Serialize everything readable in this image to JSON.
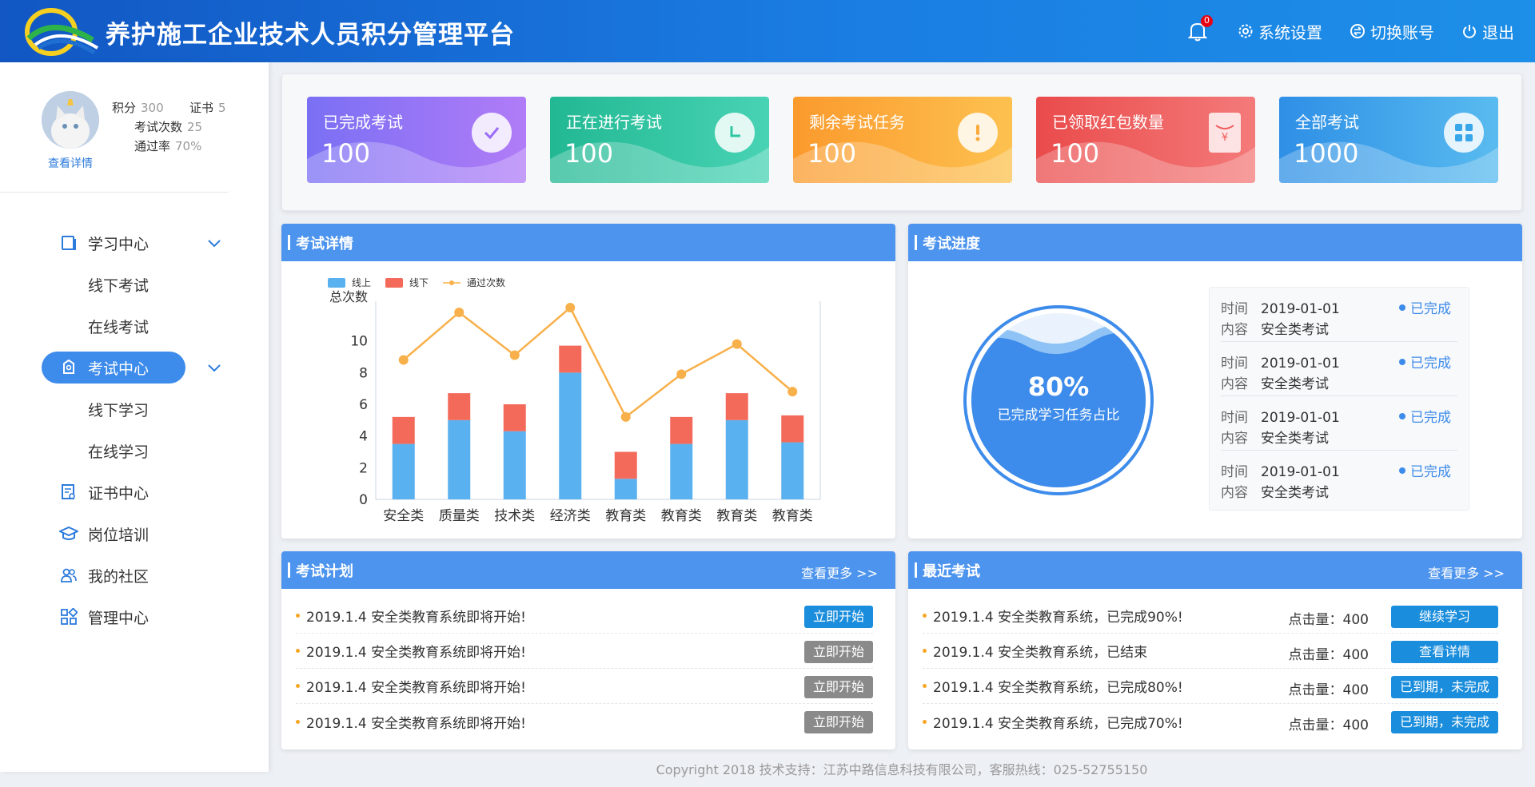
{
  "header": {
    "title": "养护施工企业技术人员积分管理平台",
    "notification_count": "0",
    "settings_label": "系统设置",
    "switch_account_label": "切换账号",
    "logout_label": "退出"
  },
  "profile": {
    "score_label": "积分",
    "score_value": "300",
    "cert_label": "证书",
    "cert_value": "5",
    "exam_count_label": "考试次数",
    "exam_count_value": "25",
    "pass_rate_label": "通过率",
    "pass_rate_value": "70%",
    "view_detail": "查看详情"
  },
  "sidebar": {
    "items": [
      {
        "label": "学习中心",
        "icon": "book-icon"
      },
      {
        "label": "线下考试"
      },
      {
        "label": "在线考试"
      },
      {
        "label": "考试中心",
        "icon": "exam-icon"
      },
      {
        "label": "线下学习"
      },
      {
        "label": "在线学习"
      },
      {
        "label": "证书中心",
        "icon": "certificate-icon"
      },
      {
        "label": "岗位培训",
        "icon": "graduation-cap-icon"
      },
      {
        "label": "我的社区",
        "icon": "community-icon"
      },
      {
        "label": "管理中心",
        "icon": "grid-icon"
      }
    ]
  },
  "kpis": [
    {
      "title": "已完成考试",
      "value": "100",
      "icon": "check-icon",
      "color": "#9b6cf7"
    },
    {
      "title": "正在进行考试",
      "value": "100",
      "icon": "clock-icon",
      "color": "#2dc6a0"
    },
    {
      "title": "剩余考试任务",
      "value": "100",
      "icon": "exclamation-icon",
      "color": "#fba93c"
    },
    {
      "title": "已领取红包数量",
      "value": "100",
      "icon": "red-packet-icon",
      "color": "#ef5b5b"
    },
    {
      "title": "全部考试",
      "value": "1000",
      "icon": "grid-icon",
      "color": "#3aa6ea"
    }
  ],
  "exam_detail": {
    "title": "考试详情",
    "legend": [
      "线上",
      "线下",
      "通过次数"
    ]
  },
  "chart_data": {
    "type": "bar",
    "categories": [
      "安全类",
      "质量类",
      "技术类",
      "经济类",
      "教育类",
      "教育类",
      "教育类",
      "教育类"
    ],
    "ylabel": "总次数",
    "ylim": [
      0,
      12
    ],
    "yticks": [
      0,
      2,
      4,
      6,
      8,
      10
    ],
    "stacked": true,
    "series": [
      {
        "name": "线上",
        "type": "bar",
        "color": "#5ab1ef",
        "values": [
          3.5,
          5.0,
          4.3,
          8.0,
          1.3,
          3.5,
          5.0,
          3.6
        ]
      },
      {
        "name": "线下",
        "type": "bar",
        "color": "#f36a5a",
        "values": [
          1.7,
          1.7,
          1.7,
          1.7,
          1.7,
          1.7,
          1.7,
          1.7
        ]
      },
      {
        "name": "通过次数",
        "type": "line",
        "color": "#f8b04a",
        "values": [
          8.8,
          11.8,
          9.1,
          12.1,
          5.2,
          7.9,
          9.8,
          6.8
        ]
      }
    ]
  },
  "exam_progress": {
    "title": "考试进度",
    "percent": "80%",
    "percent_label": "已完成学习任务占比",
    "time_label": "时间",
    "content_label": "内容",
    "items": [
      {
        "time": "2019-01-01",
        "content": "安全类考试",
        "status": "已完成"
      },
      {
        "time": "2019-01-01",
        "content": "安全类考试",
        "status": "已完成"
      },
      {
        "time": "2019-01-01",
        "content": "安全类考试",
        "status": "已完成"
      },
      {
        "time": "2019-01-01",
        "content": "安全类考试",
        "status": "已完成"
      }
    ]
  },
  "exam_plan": {
    "title": "考试计划",
    "more": "查看更多 >>",
    "items": [
      {
        "text": "2019.1.4 安全类教育系统即将开始!",
        "button": "立即开始",
        "active": true
      },
      {
        "text": "2019.1.4 安全类教育系统即将开始!",
        "button": "立即开始",
        "active": false
      },
      {
        "text": "2019.1.4 安全类教育系统即将开始!",
        "button": "立即开始",
        "active": false
      },
      {
        "text": "2019.1.4 安全类教育系统即将开始!",
        "button": "立即开始",
        "active": false
      }
    ]
  },
  "recent_exams": {
    "title": "最近考试",
    "more": "查看更多 >>",
    "clicks_label": "点击量：",
    "items": [
      {
        "text": "2019.1.4 安全类教育系统，已完成90%!",
        "clicks": "400",
        "button": "继续学习"
      },
      {
        "text": "2019.1.4 安全类教育系统，已结束",
        "clicks": "400",
        "button": "查看详情"
      },
      {
        "text": "2019.1.4 安全类教育系统，已完成80%!",
        "clicks": "400",
        "button": "已到期，未完成"
      },
      {
        "text": "2019.1.4 安全类教育系统，已完成70%!",
        "clicks": "400",
        "button": "已到期，未完成"
      }
    ]
  },
  "footer": {
    "copyright": "Copyright 2018 技术支持：江苏中路信息科技有限公司，客服热线：025-52755150"
  }
}
